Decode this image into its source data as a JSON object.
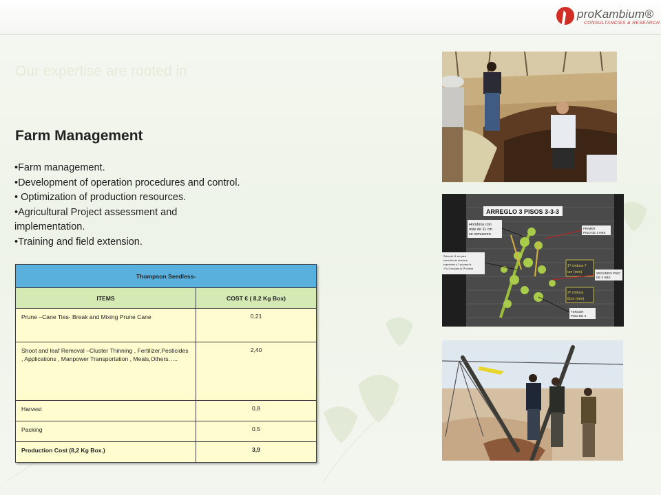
{
  "header": {
    "logo_name": "proKambium®",
    "logo_tagline": "CONSULTANCIES & RESEARCH"
  },
  "faint_heading": "Our expertise are rooted in",
  "section_title": "Farm Management",
  "bullets": [
    "•Farm management.",
    "•Development of operation procedures and control.",
    "• Optimization of production resources.",
    "•Agricultural Project assessment and implementation.",
    "•Training and field extension."
  ],
  "table": {
    "title": "Thompson Seedless-",
    "columns": [
      "ITEMS",
      "COST €  ( 8,2 Kg Box)"
    ],
    "rows": [
      {
        "item": "Prune –Cane Ties- Break and Mixing Prune Cane",
        "cost": "0.21"
      },
      {
        "item": "Shoot and leaf Removal –Cluster Thinning , Fertilizer,Pesticides , Applications , Manpower Transportation , Meals,Others…..",
        "cost": "2,40"
      },
      {
        "item": "Harvest",
        "cost": "0,8"
      },
      {
        "item": "Packing",
        "cost": "0.5"
      },
      {
        "item": "Production Cost  (8,2 Kg Box.)",
        "cost": "3,9"
      }
    ]
  },
  "diagram": {
    "title": "ARREGLO 3 PISOS 3-3-3",
    "labels": [
      "Hombros con más de 11 cm se remueven",
      "PRIMER PISO DE 3 HBS",
      "1ª cintura 7 cm (min)",
      "SEGUNDO PISO DE 3 HBS",
      "2ª cintura 8cm (min)",
      "TERCER PISO DE 3",
      "Palos de 11 cm para remoción de hombros superiores y 7 cm para la 1ª y 3 cm para la 2ª cintura (anillos)"
    ]
  },
  "colors": {
    "table_header": "#5ab0dc",
    "column_header": "#d5e9b5",
    "body_cell": "#fffdd0",
    "brand_red": "#d12d24"
  }
}
